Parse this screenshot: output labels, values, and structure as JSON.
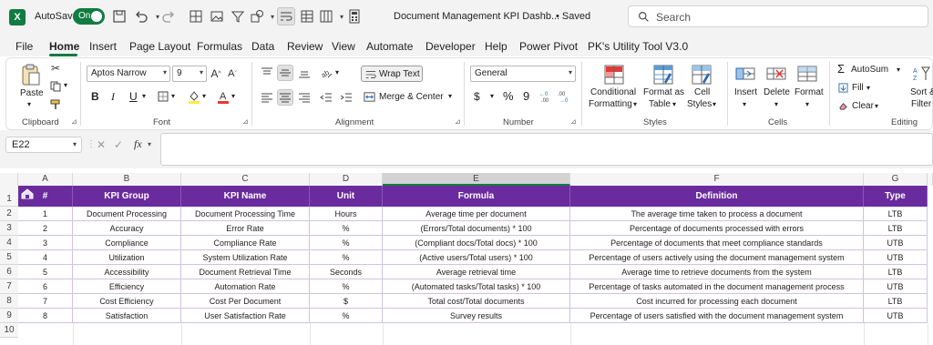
{
  "titlebar": {
    "app_icon": "X",
    "autosave_label": "AutoSave",
    "autosave_state": "On",
    "document_title": "Document Management KPI Dashb...",
    "save_status": "• Saved",
    "search_placeholder": "Search"
  },
  "menu": {
    "tabs": [
      "File",
      "Home",
      "Insert",
      "Page Layout",
      "Formulas",
      "Data",
      "Review",
      "View",
      "Automate",
      "Developer",
      "Help",
      "Power Pivot",
      "PK's Utility Tool V3.0"
    ],
    "active_tab": "Home"
  },
  "ribbon": {
    "clipboard": {
      "paste": "Paste",
      "group": "Clipboard"
    },
    "font": {
      "name": "Aptos Narrow",
      "size": "9",
      "bold": "B",
      "italic": "I",
      "underline": "U",
      "group": "Font"
    },
    "alignment": {
      "wrap_text": "Wrap Text",
      "merge_center": "Merge & Center",
      "group": "Alignment"
    },
    "number": {
      "format": "General",
      "currency": "$",
      "percent": "%",
      "comma": "9",
      "group": "Number"
    },
    "styles": {
      "conditional": "Conditional",
      "formatting": "Formatting",
      "format_as": "Format as",
      "table": "Table",
      "cell": "Cell",
      "cell_styles": "Styles",
      "group": "Styles"
    },
    "cells": {
      "insert": "Insert",
      "delete": "Delete",
      "format": "Format",
      "group": "Cells"
    },
    "editing": {
      "autosum": "AutoSum",
      "fill": "Fill",
      "clear": "Clear",
      "sort": "Sort &",
      "filter": "Filter",
      "group": "Editing"
    }
  },
  "formula_bar": {
    "name_box": "E22",
    "fx": "fx",
    "formula": ""
  },
  "sheet": {
    "columns": [
      "A",
      "B",
      "C",
      "D",
      "E",
      "F",
      "G"
    ],
    "selected_column": "E",
    "row_numbers": [
      "1",
      "2",
      "3",
      "4",
      "5",
      "6",
      "7",
      "8",
      "9",
      "10"
    ],
    "headers": [
      "#",
      "KPI Group",
      "KPI Name",
      "Unit",
      "Formula",
      "Definition",
      "Type"
    ],
    "rows": [
      [
        "1",
        "Document Processing",
        "Document Processing Time",
        "Hours",
        "Average time per document",
        "The average time taken to process a document",
        "LTB"
      ],
      [
        "2",
        "Accuracy",
        "Error Rate",
        "%",
        "(Errors/Total documents) * 100",
        "Percentage of documents processed with errors",
        "LTB"
      ],
      [
        "3",
        "Compliance",
        "Compliance Rate",
        "%",
        "(Compliant docs/Total docs) * 100",
        "Percentage of documents that meet compliance standards",
        "UTB"
      ],
      [
        "4",
        "Utilization",
        "System Utilization Rate",
        "%",
        "(Active users/Total users) * 100",
        "Percentage of users actively using the document management system",
        "UTB"
      ],
      [
        "5",
        "Accessibility",
        "Document Retrieval Time",
        "Seconds",
        "Average retrieval time",
        "Average time to retrieve documents from the system",
        "LTB"
      ],
      [
        "6",
        "Efficiency",
        "Automation Rate",
        "%",
        "(Automated tasks/Total tasks) * 100",
        "Percentage of tasks automated in the document management process",
        "UTB"
      ],
      [
        "7",
        "Cost Efficiency",
        "Cost Per Document",
        "$",
        "Total cost/Total documents",
        "Cost incurred for processing each document",
        "LTB"
      ],
      [
        "8",
        "Satisfaction",
        "User Satisfaction Rate",
        "%",
        "Survey results",
        "Percentage of users satisfied with the document management system",
        "UTB"
      ]
    ],
    "header_color": "#6a2b9e",
    "accent_color": "#107c41"
  }
}
